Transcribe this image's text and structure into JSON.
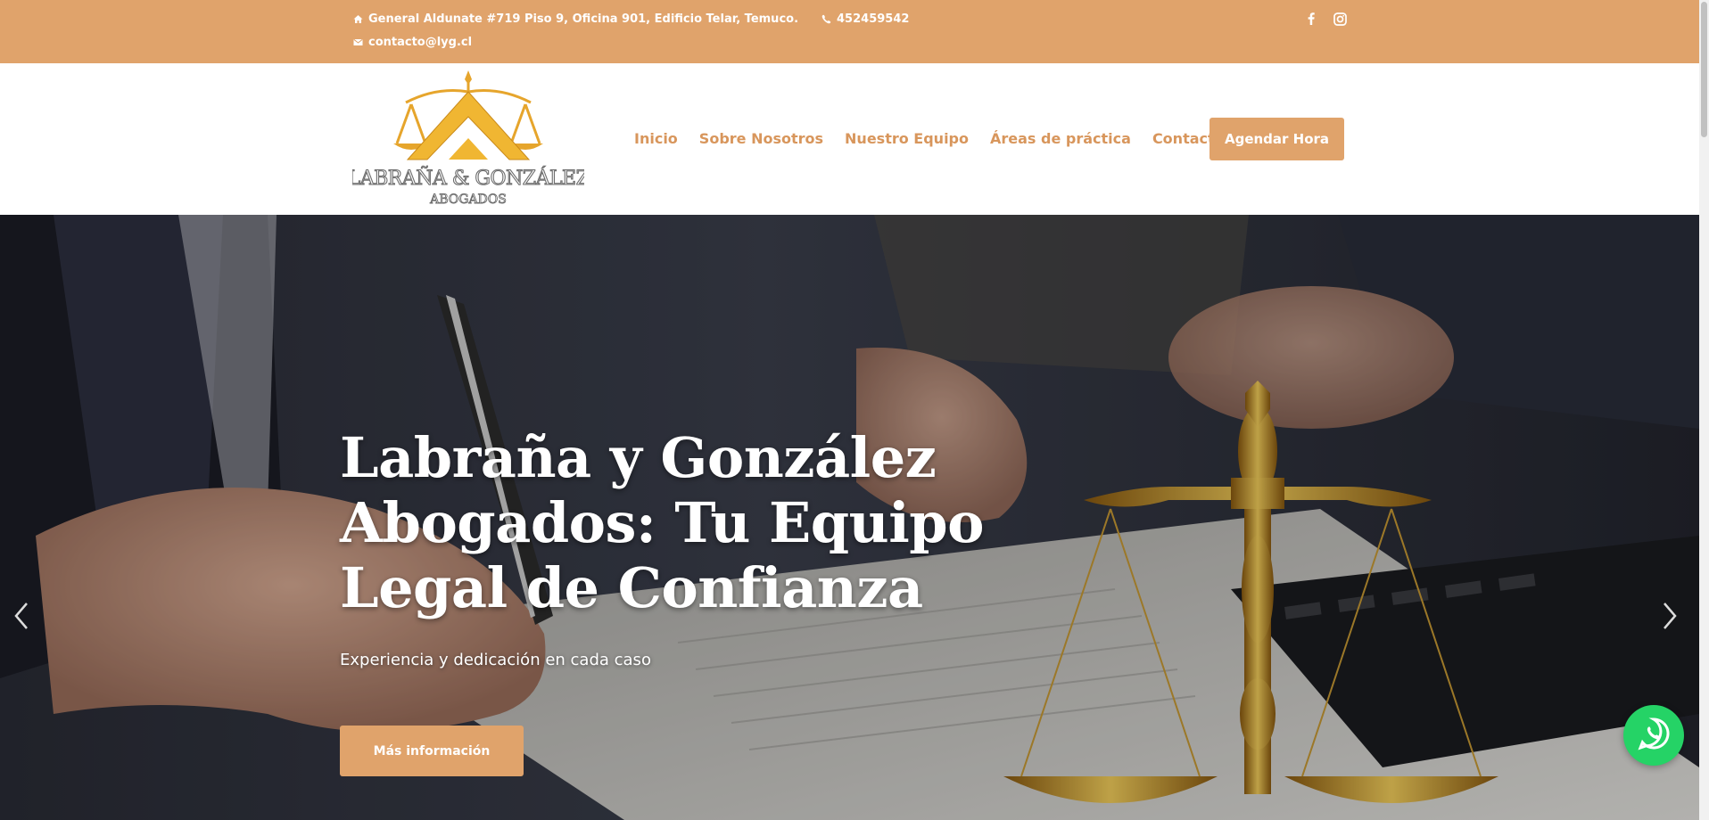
{
  "topbar": {
    "address": "General Aldunate #719 Piso 9, Oficina 901, Edificio Telar, Temuco.",
    "phone": "452459542",
    "email": "contacto@lyg.cl",
    "social": [
      "facebook-icon",
      "instagram-icon"
    ]
  },
  "header": {
    "logo": {
      "line1": "LABRAÑA & GONZÁLEZ",
      "line2": "ABOGADOS"
    },
    "nav": {
      "items": [
        {
          "label": "Inicio"
        },
        {
          "label": "Sobre Nosotros"
        },
        {
          "label": "Nuestro Equipo"
        },
        {
          "label": "Áreas de práctica"
        },
        {
          "label": "Contacto"
        }
      ],
      "cta_label": "Agendar Hora"
    }
  },
  "hero": {
    "title": "Labraña y González Abogados: Tu Equipo Legal de Confianza",
    "subtitle": "Experiencia y dedicación en cada caso",
    "button_label": "Más información",
    "prev_icon": "chevron-left-icon",
    "next_icon": "chevron-right-icon"
  },
  "floating": {
    "icon": "whatsapp-icon"
  },
  "colors": {
    "accent": "#e0a36b",
    "nav_text": "#d8965c",
    "whatsapp": "#25d366"
  }
}
